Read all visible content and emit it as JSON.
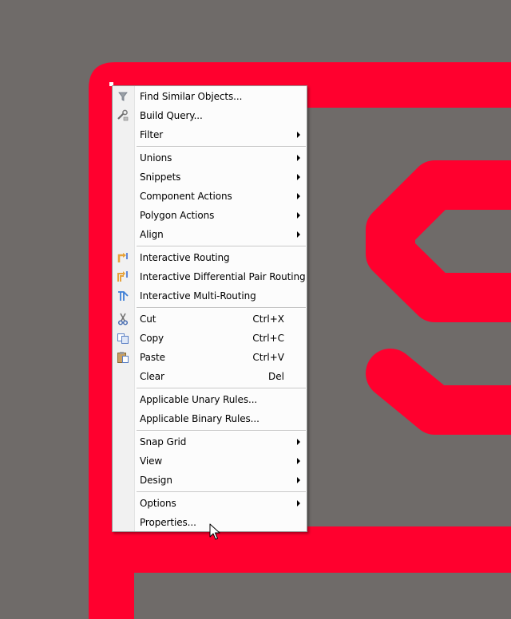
{
  "colors": {
    "background": "#6f6b69",
    "trace": "#ff002e",
    "menu_bg": "#fcfcfc",
    "menu_gutter": "#f1f1f1",
    "separator": "#c6c6c6"
  },
  "menu": {
    "items": [
      {
        "label": "Find Similar Objects...",
        "icon": "funnel-icon"
      },
      {
        "label": "Build Query...",
        "icon": "query-builder-icon"
      },
      {
        "label": "Filter",
        "submenu": true
      },
      {
        "label": "Unions",
        "submenu": true
      },
      {
        "label": "Snippets",
        "submenu": true
      },
      {
        "label": "Component Actions",
        "submenu": true
      },
      {
        "label": "Polygon Actions",
        "submenu": true
      },
      {
        "label": "Align",
        "submenu": true
      },
      {
        "label": "Interactive Routing",
        "icon": "interactive-routing-icon"
      },
      {
        "label": "Interactive Differential Pair Routing",
        "icon": "diff-pair-routing-icon"
      },
      {
        "label": "Interactive Multi-Routing",
        "icon": "multi-routing-icon"
      },
      {
        "label": "Cut",
        "shortcut": "Ctrl+X",
        "icon": "scissors-icon"
      },
      {
        "label": "Copy",
        "shortcut": "Ctrl+C",
        "icon": "copy-icon"
      },
      {
        "label": "Paste",
        "shortcut": "Ctrl+V",
        "icon": "paste-icon"
      },
      {
        "label": "Clear",
        "shortcut": "Del"
      },
      {
        "label": "Applicable Unary Rules..."
      },
      {
        "label": "Applicable Binary Rules..."
      },
      {
        "label": "Snap Grid",
        "submenu": true
      },
      {
        "label": "View",
        "submenu": true
      },
      {
        "label": "Design",
        "submenu": true
      },
      {
        "label": "Options",
        "submenu": true
      },
      {
        "label": "Properties..."
      }
    ]
  }
}
